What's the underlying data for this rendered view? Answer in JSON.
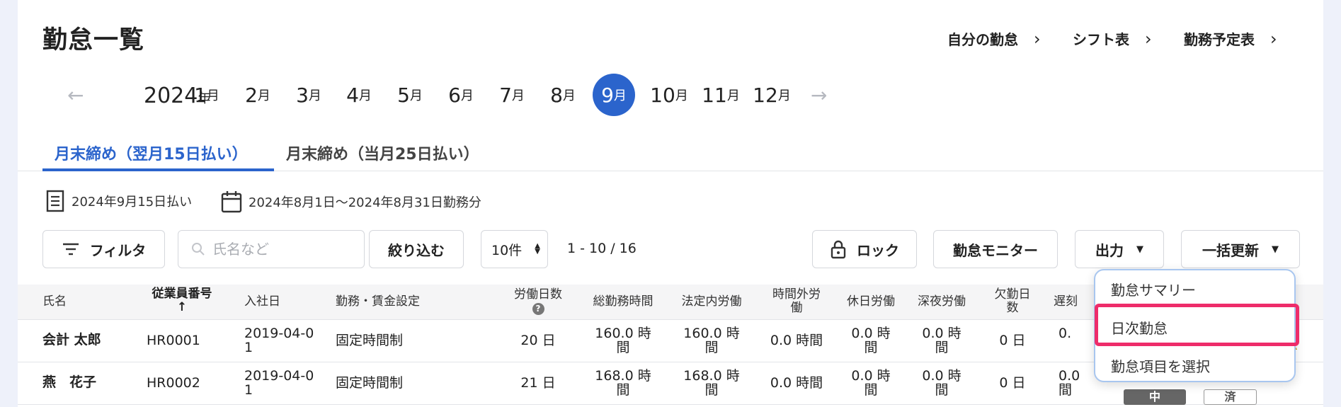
{
  "page_title": "勤怠一覧",
  "header_links": [
    {
      "label": "自分の勤怠"
    },
    {
      "label": "シフト表"
    },
    {
      "label": "勤務予定表"
    }
  ],
  "year": {
    "number": "2024",
    "unit": "年"
  },
  "month_unit": "月",
  "months": [
    "1",
    "2",
    "3",
    "4",
    "5",
    "6",
    "7",
    "8",
    "9",
    "10",
    "11",
    "12"
  ],
  "selected_month": "9",
  "tabs": [
    {
      "label": "月末締め（翌月15日払い）",
      "active": true
    },
    {
      "label": "月末締め（当月25日払い）",
      "active": false
    }
  ],
  "pay_date": "2024年9月15日払い",
  "work_period": "2024年8月1日〜2024年8月31日勤務分",
  "toolbar": {
    "filter_label": "フィルタ",
    "search_placeholder": "氏名など",
    "narrow_label": "絞り込む",
    "per_page": "10件",
    "range": "1 - 10 / 16",
    "lock_label": "ロック",
    "monitor_label": "勤怠モニター",
    "output_label": "出力",
    "bulk_update_label": "一括更新"
  },
  "columns": {
    "name": "氏名",
    "employee_no": "従業員番号",
    "sort_arrow": "↑",
    "hire_date": "入社日",
    "wage_setting": "勤務・賃金設定",
    "work_days": "労働日数",
    "help": "?",
    "total_hours": "総勤務時間",
    "legal_hours": "法定内労働",
    "overtime_1": "時間外労",
    "overtime_2": "働",
    "holiday": "休日労働",
    "night": "深夜労働",
    "absence_1": "欠勤日",
    "absence_2": "数",
    "late": "遅刻"
  },
  "rows": [
    {
      "name": "会計 太郎",
      "employee_no": "HR0001",
      "hire_date_1": "2019-04-0",
      "hire_date_2": "1",
      "wage_setting": "固定時間制",
      "work_days": "20 日",
      "total_1": "160.0 時",
      "total_2": "間",
      "legal_1": "160.0 時",
      "legal_2": "間",
      "overtime": "0.0 時間",
      "holiday_1": "0.0 時",
      "holiday_2": "間",
      "night_1": "0.0 時",
      "night_2": "間",
      "absence": "0 日",
      "late_1": "0.",
      "late_2": "",
      "warn": "!"
    },
    {
      "name": "燕　花子",
      "employee_no": "HR0002",
      "hire_date_1": "2019-04-0",
      "hire_date_2": "1",
      "wage_setting": "固定時間制",
      "work_days": "21 日",
      "total_1": "168.0 時",
      "total_2": "間",
      "legal_1": "168.0 時",
      "legal_2": "間",
      "overtime": "0.0 時間",
      "holiday_1": "0.0 時",
      "holiday_2": "間",
      "night_1": "0.0 時",
      "night_2": "間",
      "absence": "0 日",
      "late_1": "0.0",
      "late_2": "間",
      "badge_1": "中",
      "badge_2": "済"
    }
  ],
  "output_menu": [
    {
      "label": "勤怠サマリー"
    },
    {
      "label": "日次勤怠"
    },
    {
      "label": "勤怠項目を選択"
    }
  ],
  "colors": {
    "accent": "#2b64cc",
    "highlight": "#ee2c6a",
    "warning": "#c9961a"
  }
}
